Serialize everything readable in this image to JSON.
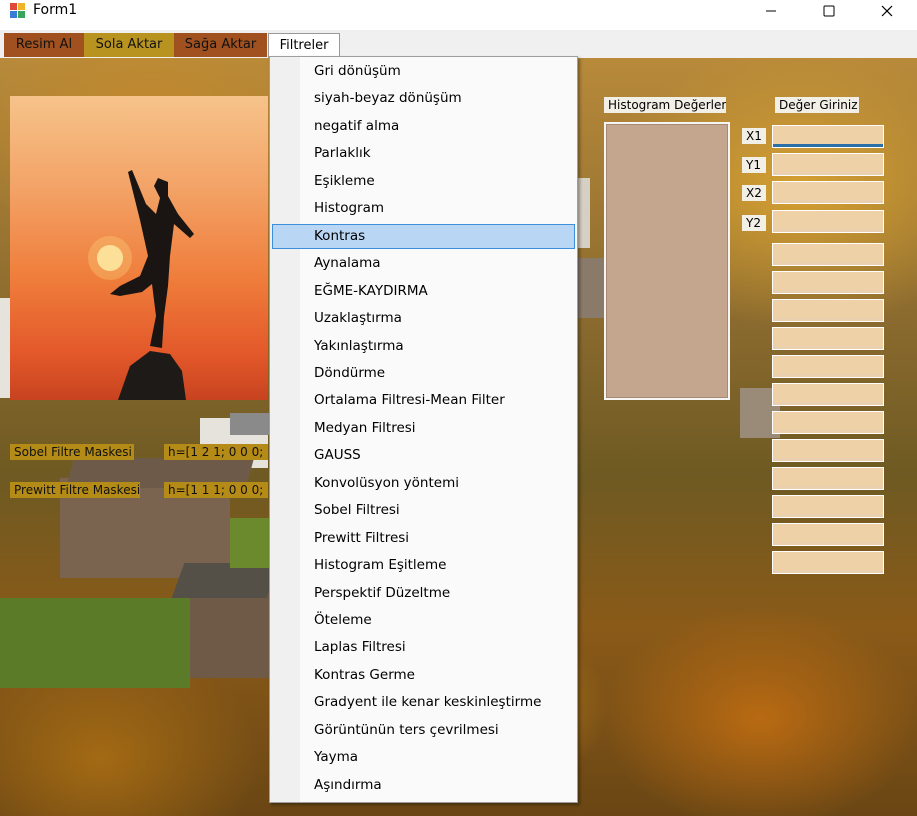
{
  "window": {
    "title": "Form1"
  },
  "menubar": {
    "items": [
      "Resim Al",
      "Sola Aktar",
      "Sağa Aktar",
      "Filtreler"
    ]
  },
  "dropdown": {
    "highlighted_index": 6,
    "items": [
      "Gri dönüşüm",
      "siyah-beyaz dönüşüm",
      "negatif alma",
      "Parlaklık",
      "Eşikleme",
      "Histogram",
      "Kontras",
      "Aynalama",
      "EĞME-KAYDIRMA",
      "Uzaklaştırma",
      "Yakınlaştırma",
      "Döndürme",
      "Ortalama Filtresi-Mean Filter",
      "Medyan Filtresi",
      "GAUSS",
      "Konvolüsyon yöntemi",
      "Sobel Filtresi",
      "Prewitt  Filtresi",
      "Histogram Eşitleme",
      "Perspektif Düzeltme",
      "Öteleme",
      "Laplas Filtresi",
      "Kontras Germe",
      "Gradyent ile kenar keskinleştirme",
      "Görüntünün ters çevrilmesi",
      " Yayma",
      "Aşındırma"
    ]
  },
  "labels": {
    "sobel": "Sobel Filtre Maskesi",
    "sobel_value": "h=[1 2 1;  0 0 0;",
    "prewitt": "Prewitt Filtre Maskesi",
    "prewitt_value": "h=[1 1 1;  0 0 0;",
    "histogram": "Histogram Değerleri",
    "input": "Değer Giriniz",
    "x1": "X1",
    "y1": "Y1",
    "x2": "X2",
    "y2": "Y2"
  }
}
